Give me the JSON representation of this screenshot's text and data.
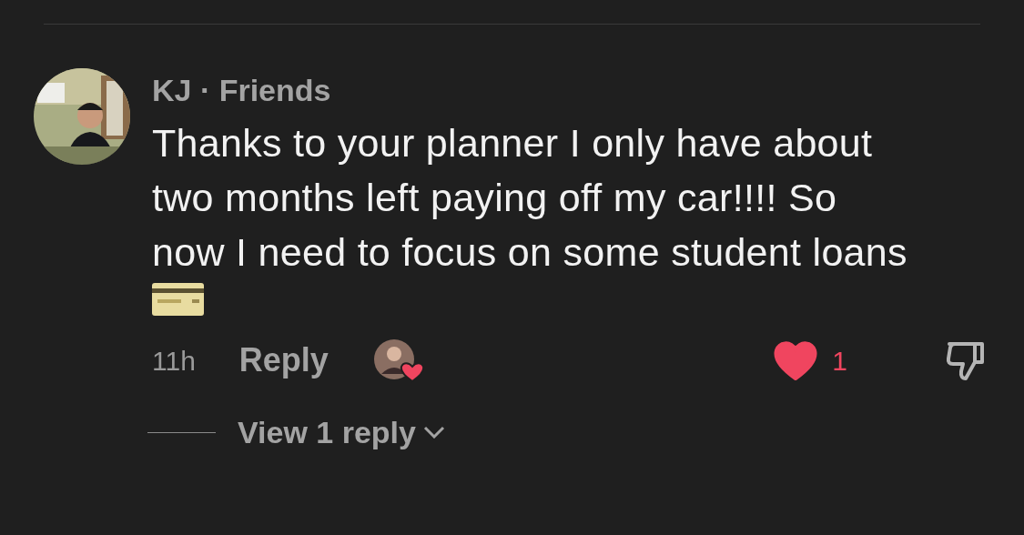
{
  "comment": {
    "author": "KJ",
    "relation": "Friends",
    "separator": "·",
    "text": "Thanks to your planner I only have about two months left paying off my car!!!! So now I need to focus on some student loans",
    "time": "11h",
    "reply_label": "Reply",
    "liked_by_creator": true,
    "liked": true,
    "likes": "1",
    "view_replies": "View 1 reply"
  }
}
